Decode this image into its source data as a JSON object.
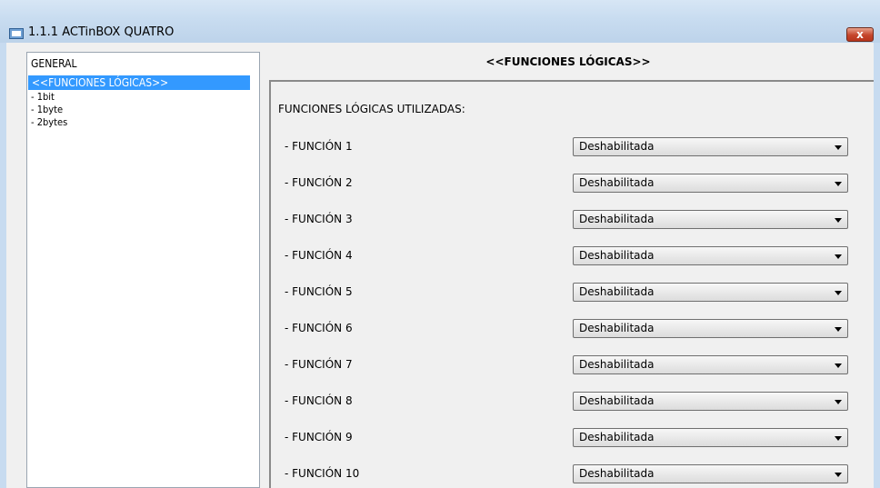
{
  "window": {
    "title": "1.1.1 ACTinBOX QUATRO",
    "close_label": "x"
  },
  "sidebar": {
    "items": [
      {
        "label": "GENERAL",
        "selected": false
      },
      {
        "label": "<<FUNCIONES LÓGICAS>>",
        "selected": true
      },
      {
        "label": "- 1bit",
        "selected": false
      },
      {
        "label": "- 1byte",
        "selected": false
      },
      {
        "label": "- 2bytes",
        "selected": false
      }
    ]
  },
  "main": {
    "heading": "<<FUNCIONES LÓGICAS>>",
    "section_label": "FUNCIONES LÓGICAS UTILIZADAS:",
    "functions": [
      {
        "label": "- FUNCIÓN 1",
        "value": "Deshabilitada"
      },
      {
        "label": "- FUNCIÓN 2",
        "value": "Deshabilitada"
      },
      {
        "label": "- FUNCIÓN 3",
        "value": "Deshabilitada"
      },
      {
        "label": "- FUNCIÓN 4",
        "value": "Deshabilitada"
      },
      {
        "label": "- FUNCIÓN 5",
        "value": "Deshabilitada"
      },
      {
        "label": "- FUNCIÓN 6",
        "value": "Deshabilitada"
      },
      {
        "label": "- FUNCIÓN 7",
        "value": "Deshabilitada"
      },
      {
        "label": "- FUNCIÓN 8",
        "value": "Deshabilitada"
      },
      {
        "label": "- FUNCIÓN 9",
        "value": "Deshabilitada"
      },
      {
        "label": "- FUNCIÓN 10",
        "value": "Deshabilitada"
      }
    ]
  },
  "colors": {
    "selection": "#3399ff",
    "close_button": "#c5452b",
    "title_bar": "#c8dcf0"
  }
}
